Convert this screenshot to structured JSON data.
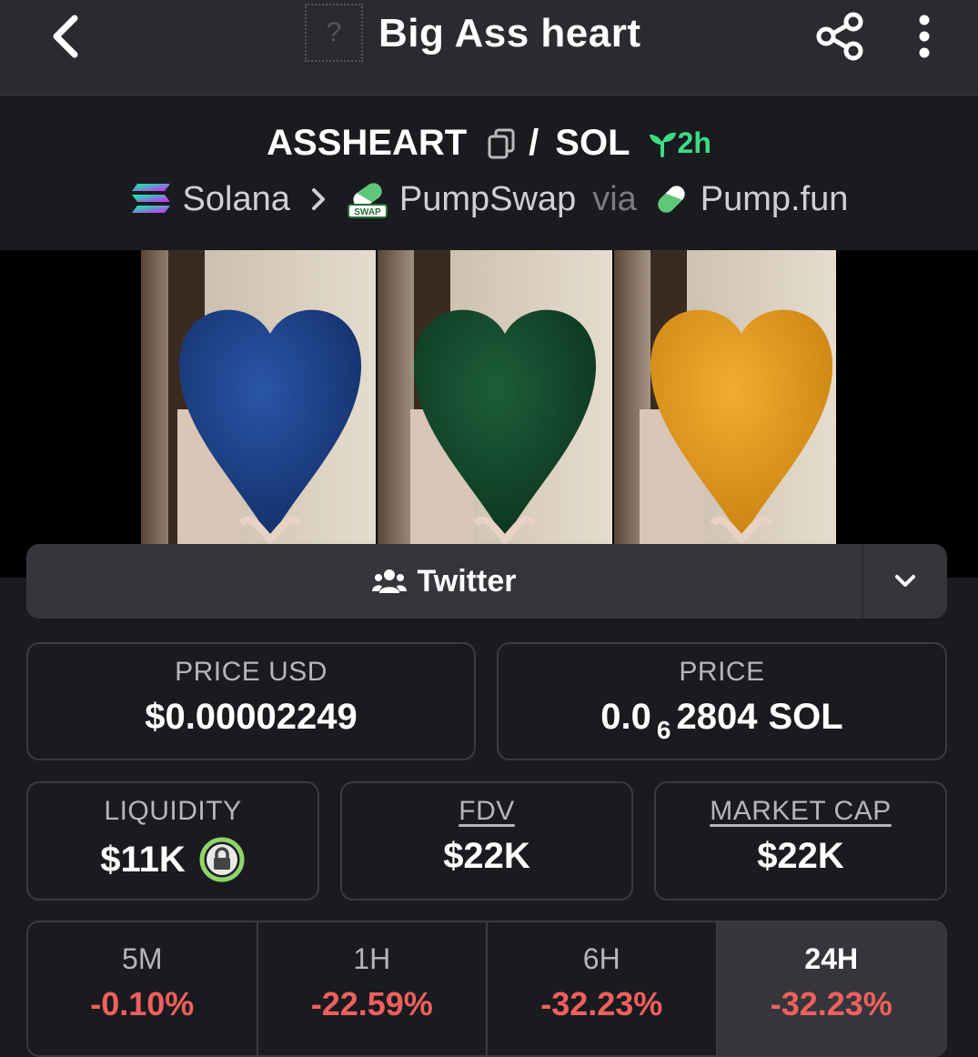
{
  "header": {
    "title": "Big Ass heart",
    "token_placeholder": "?",
    "icons": [
      "chevron-left-icon",
      "share-icon",
      "more-vertical-icon"
    ]
  },
  "pair": {
    "base": "ASSHEART",
    "separator": "/",
    "quote": "SOL",
    "age": "2h",
    "chain": "Solana",
    "dex": "PumpSwap",
    "dex_badge": "SWAP",
    "via": "via",
    "launchpad": "Pump.fun"
  },
  "social": {
    "label": "Twitter"
  },
  "stats": {
    "price_usd": {
      "label": "PRICE USD",
      "value": "$0.00002249"
    },
    "price_native": {
      "label": "PRICE",
      "prefix": "0.0",
      "zeros": "6",
      "digits": "2804",
      "unit": "SOL"
    },
    "liquidity": {
      "label": "LIQUIDITY",
      "value": "$11K"
    },
    "fdv": {
      "label": "FDV",
      "value": "$22K"
    },
    "market_cap": {
      "label": "MARKET CAP",
      "value": "$22K"
    }
  },
  "timeframes": [
    {
      "label": "5M",
      "change": "-0.10%"
    },
    {
      "label": "1H",
      "change": "-22.59%"
    },
    {
      "label": "6H",
      "change": "-32.23%"
    },
    {
      "label": "24H",
      "change": "-32.23%"
    }
  ],
  "colors": {
    "background": "#1a1b1f",
    "topbar": "#2a2b30",
    "negative": "#f0605d",
    "positive": "#3ddc84",
    "heart_blue": "#1c3f86",
    "heart_green": "#13452a",
    "heart_orange": "#e0981c"
  }
}
